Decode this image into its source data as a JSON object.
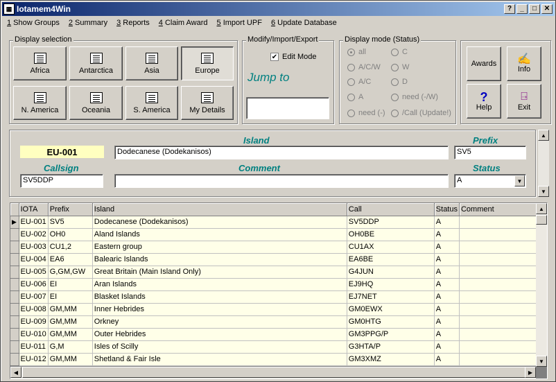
{
  "window": {
    "title": "Iotamem4Win",
    "icon": "iota-app-icon",
    "controls": [
      "?",
      "_",
      "□",
      "✕"
    ]
  },
  "menu": [
    {
      "key": "1",
      "label": " Show Groups"
    },
    {
      "key": "2",
      "label": " Summary"
    },
    {
      "key": "3",
      "label": " Reports"
    },
    {
      "key": "4",
      "label": " Claim Award"
    },
    {
      "key": "5",
      "label": " Import UPF"
    },
    {
      "key": "6",
      "label": " Update Database"
    }
  ],
  "display_selection": {
    "caption": "Display selection",
    "buttons": [
      "Africa",
      "Antarctica",
      "Asia",
      "Europe",
      "N. America",
      "Oceania",
      "S. America",
      "My Details"
    ],
    "selected": "Europe"
  },
  "modify": {
    "caption": "Modify/Import/Export",
    "edit_mode_label": "Edit Mode",
    "edit_mode_checked": true,
    "jump_to_label": "Jump to",
    "jump_to_value": ""
  },
  "display_mode": {
    "caption": "Display mode (Status)",
    "options": [
      "all",
      "C",
      "A/C/W",
      "W",
      "A/C",
      "D",
      "A",
      "need (-/W)",
      "need (-)",
      "/Call (Update!)"
    ],
    "selected": "all"
  },
  "side_buttons": {
    "awards": "Awards",
    "info": "Info",
    "help": "Help",
    "exit": "Exit"
  },
  "record": {
    "iota": "EU-001",
    "island_label": "Island",
    "island": "Dodecanese (Dodekanisos)",
    "prefix_label": "Prefix",
    "prefix": "SV5",
    "callsign_label": "Callsign",
    "callsign": "SV5DDP",
    "comment_label": "Comment",
    "comment": "",
    "status_label": "Status",
    "status": "A"
  },
  "table": {
    "columns": [
      "IOTA",
      "Prefix",
      "Island",
      "Call",
      "Status",
      "Comment"
    ],
    "rows": [
      [
        "EU-001",
        "SV5",
        "Dodecanese (Dodekanisos)",
        "SV5DDP",
        "A",
        ""
      ],
      [
        "EU-002",
        "OH0",
        "Aland Islands",
        "OH0BE",
        "A",
        ""
      ],
      [
        "EU-003",
        "CU1,2",
        "Eastern group",
        "CU1AX",
        "A",
        ""
      ],
      [
        "EU-004",
        "EA6",
        "Balearic Islands",
        "EA6BE",
        "A",
        ""
      ],
      [
        "EU-005",
        "G,GM,GW",
        "Great Britain (Main Island Only)",
        "G4JUN",
        "A",
        ""
      ],
      [
        "EU-006",
        "EI",
        "Aran Islands",
        "EJ9HQ",
        "A",
        ""
      ],
      [
        "EU-007",
        "EI",
        "Blasket Islands",
        "EJ7NET",
        "A",
        ""
      ],
      [
        "EU-008",
        "GM,MM",
        "Inner Hebrides",
        "GM0EWX",
        "A",
        ""
      ],
      [
        "EU-009",
        "GM,MM",
        "Orkney",
        "GM0HTG",
        "A",
        ""
      ],
      [
        "EU-010",
        "GM,MM",
        "Outer Hebrides",
        "GM3PPG/P",
        "A",
        ""
      ],
      [
        "EU-011",
        "G,M",
        "Isles of Scilly",
        "G3HTA/P",
        "A",
        ""
      ],
      [
        "EU-012",
        "GM,MM",
        "Shetland & Fair Isle",
        "GM3XMZ",
        "A",
        ""
      ]
    ]
  }
}
